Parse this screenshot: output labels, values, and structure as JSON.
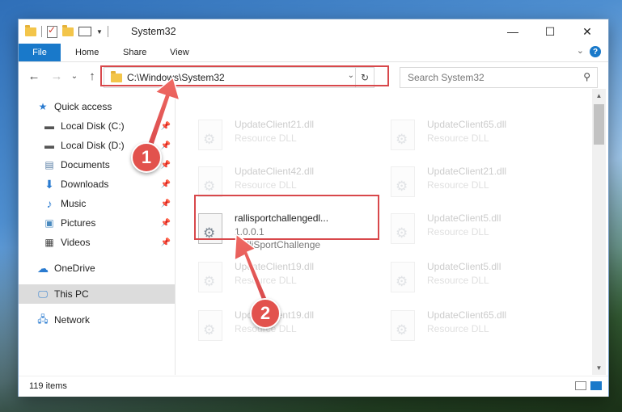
{
  "window": {
    "title": "System32",
    "controls": {
      "minimize": "—",
      "maximize": "☐",
      "close": "✕"
    }
  },
  "ribbon": {
    "tabs": [
      "File",
      "Home",
      "Share",
      "View"
    ],
    "help": "?"
  },
  "address": {
    "path": "C:\\Windows\\System32",
    "refresh": "↻"
  },
  "search": {
    "placeholder": "Search System32"
  },
  "nav": {
    "back": "←",
    "forward": "→",
    "recent": "⌄",
    "up": "↑"
  },
  "navpane": {
    "items": [
      {
        "label": "Quick access",
        "icon": "star-icon"
      },
      {
        "label": "Local Disk (C:)",
        "icon": "drive-icon",
        "pinned": true
      },
      {
        "label": "Local Disk (D:)",
        "icon": "drive-icon",
        "pinned": true
      },
      {
        "label": "Documents",
        "icon": "documents-icon",
        "pinned": true
      },
      {
        "label": "Downloads",
        "icon": "downloads-icon",
        "pinned": true
      },
      {
        "label": "Music",
        "icon": "music-icon",
        "pinned": true
      },
      {
        "label": "Pictures",
        "icon": "pictures-icon",
        "pinned": true
      },
      {
        "label": "Videos",
        "icon": "videos-icon",
        "pinned": true
      },
      {
        "label": "OneDrive",
        "icon": "cloud-icon"
      },
      {
        "label": "This PC",
        "icon": "computer-icon",
        "selected": true
      },
      {
        "label": "Network",
        "icon": "network-icon"
      }
    ]
  },
  "files": {
    "left": [
      {
        "name": "UpdateClient21.dll",
        "type": "Resource DLL"
      },
      {
        "name": "UpdateClient42.dll",
        "type": "Resource DLL"
      },
      {
        "name": "rallisportchallengedl...",
        "version": "1.0.0.1",
        "product": "RalliSportChallenge"
      },
      {
        "name": "UpdateClient19.dll",
        "type": "Resource DLL"
      },
      {
        "name": "UpdateClient19.dll",
        "type": "Resource DLL"
      }
    ],
    "right": [
      {
        "name": "UpdateClient65.dll",
        "type": "Resource DLL"
      },
      {
        "name": "UpdateClient21.dll",
        "type": "Resource DLL"
      },
      {
        "name": "UpdateClient5.dll",
        "type": "Resource DLL"
      },
      {
        "name": "UpdateClient5.dll",
        "type": "Resource DLL"
      },
      {
        "name": "UpdateClient65.dll",
        "type": "Resource DLL"
      }
    ]
  },
  "status": {
    "item_count": "119 items"
  },
  "annotations": {
    "step1": "1",
    "step2": "2"
  },
  "colors": {
    "accent": "#1979ca",
    "highlight": "#d8484b",
    "marker": "#e2524d"
  }
}
